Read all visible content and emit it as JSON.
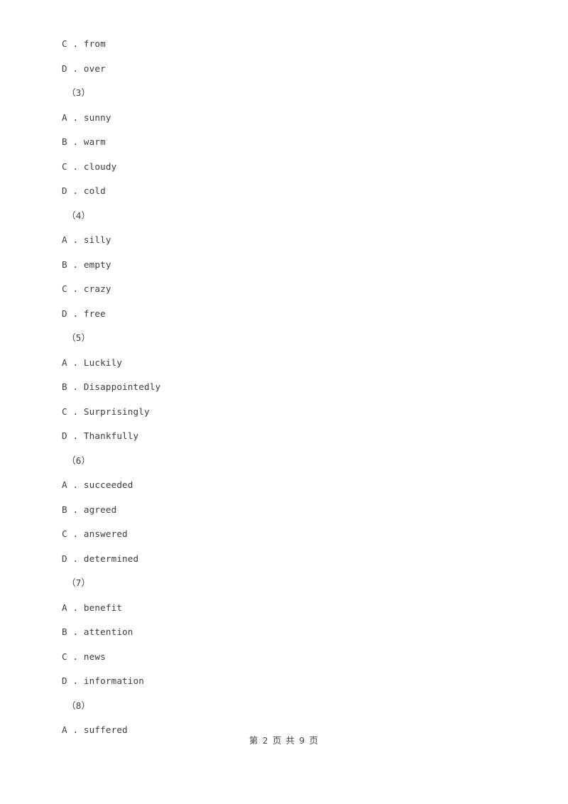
{
  "document": {
    "page_background": "#ffffff",
    "text_color": "#3c3c3c"
  },
  "lines": [
    {
      "kind": "option",
      "text": "C . from"
    },
    {
      "kind": "option",
      "text": "D . over"
    },
    {
      "kind": "question",
      "text": "（3）"
    },
    {
      "kind": "option",
      "text": "A . sunny"
    },
    {
      "kind": "option",
      "text": "B . warm"
    },
    {
      "kind": "option",
      "text": "C . cloudy"
    },
    {
      "kind": "option",
      "text": "D . cold"
    },
    {
      "kind": "question",
      "text": "（4）"
    },
    {
      "kind": "option",
      "text": "A . silly"
    },
    {
      "kind": "option",
      "text": "B . empty"
    },
    {
      "kind": "option",
      "text": "C . crazy"
    },
    {
      "kind": "option",
      "text": "D . free"
    },
    {
      "kind": "question",
      "text": "（5）"
    },
    {
      "kind": "option",
      "text": "A . Luckily"
    },
    {
      "kind": "option",
      "text": "B . Disappointedly"
    },
    {
      "kind": "option",
      "text": "C . Surprisingly"
    },
    {
      "kind": "option",
      "text": "D . Thankfully"
    },
    {
      "kind": "question",
      "text": "（6）"
    },
    {
      "kind": "option",
      "text": "A . succeeded"
    },
    {
      "kind": "option",
      "text": "B . agreed"
    },
    {
      "kind": "option",
      "text": "C . answered"
    },
    {
      "kind": "option",
      "text": "D . determined"
    },
    {
      "kind": "question",
      "text": "（7）"
    },
    {
      "kind": "option",
      "text": "A . benefit"
    },
    {
      "kind": "option",
      "text": "B . attention"
    },
    {
      "kind": "option",
      "text": "C . news"
    },
    {
      "kind": "option",
      "text": "D . information"
    },
    {
      "kind": "question",
      "text": "（8）"
    },
    {
      "kind": "option",
      "text": "A . suffered"
    }
  ],
  "footer": {
    "text": "第 2 页 共 9 页",
    "current_page": "2",
    "total_pages": "9"
  }
}
